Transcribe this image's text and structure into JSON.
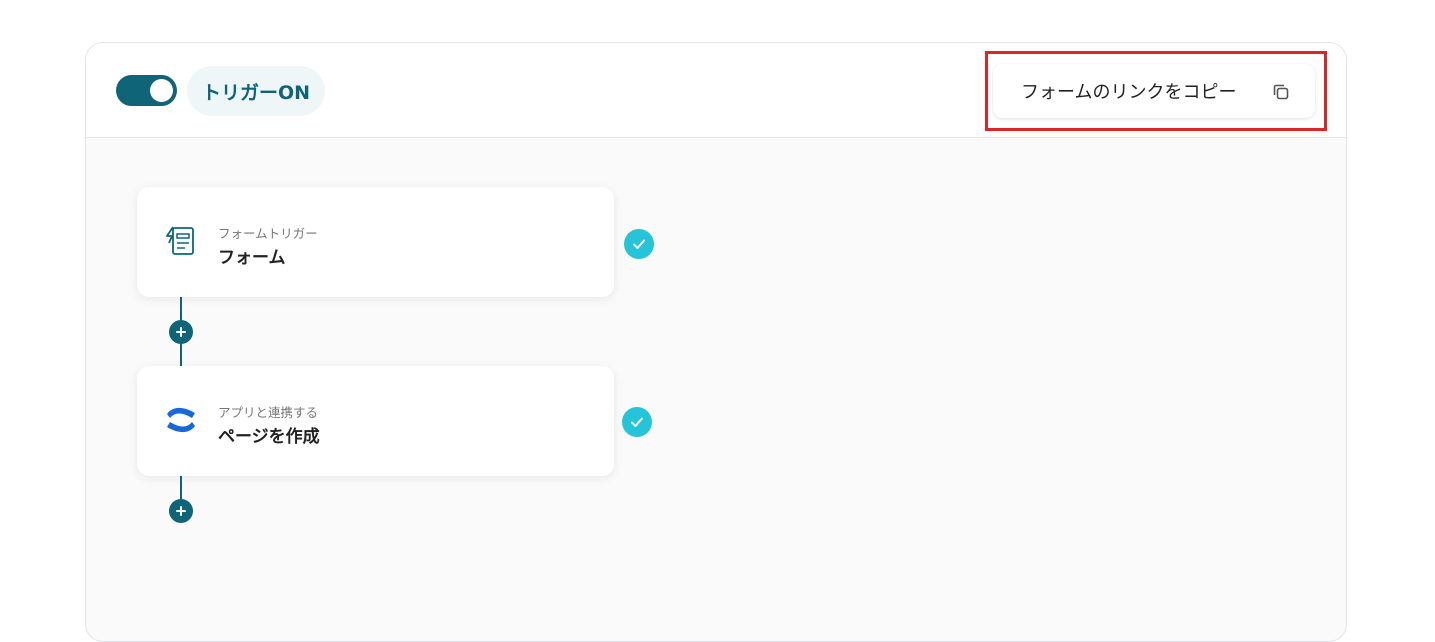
{
  "header": {
    "trigger_label": "トリガーON",
    "copy_link_label": "フォームのリンクをコピー"
  },
  "flow": {
    "steps": [
      {
        "subtitle": "フォームトリガー",
        "title": "フォーム",
        "icon": "form-trigger-icon",
        "status": "complete"
      },
      {
        "subtitle": "アプリと連携する",
        "title": "ページを作成",
        "icon": "confluence-icon",
        "status": "complete"
      }
    ]
  },
  "colors": {
    "primary": "#0f6478",
    "check": "#25c4d8",
    "highlight": "#d92626",
    "confluence_blue": "#1868db"
  }
}
